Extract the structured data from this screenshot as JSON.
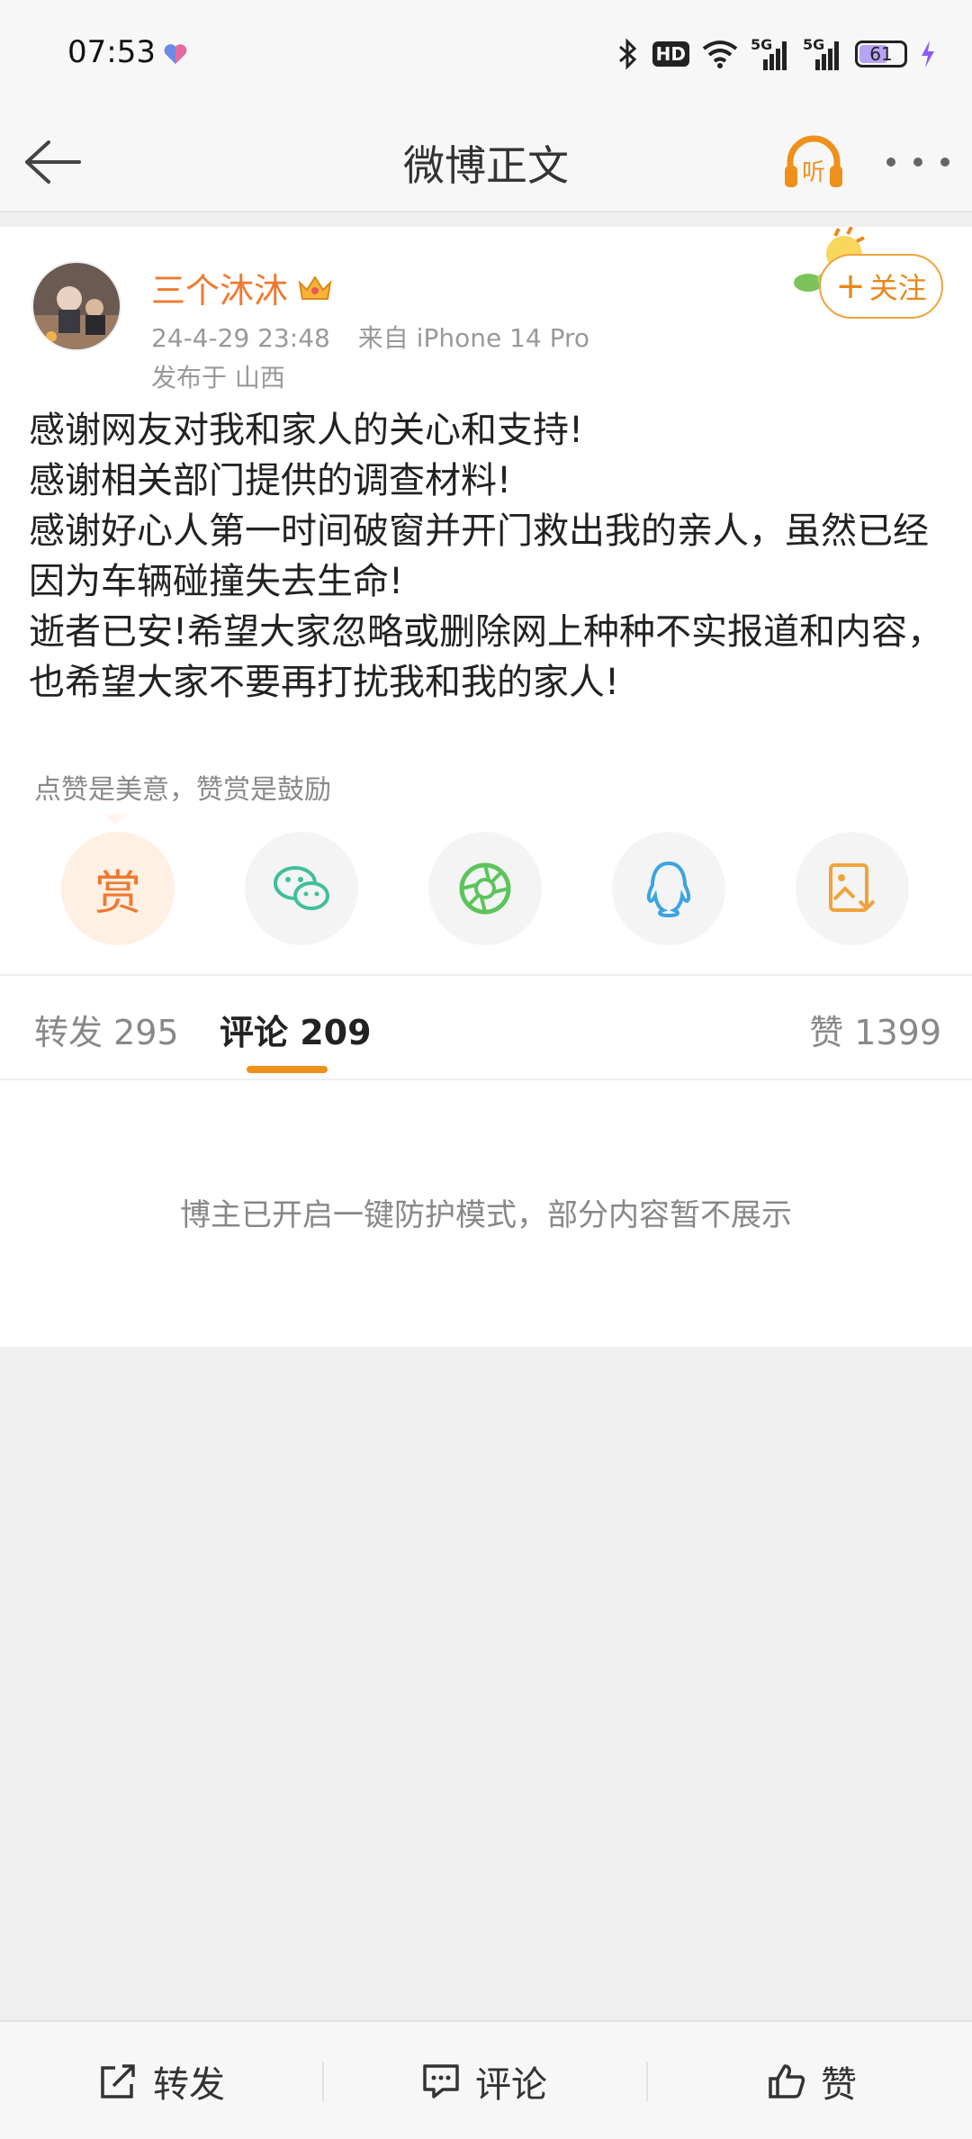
{
  "status_bar": {
    "time": "07:53",
    "battery": "61",
    "hd_label": "HD",
    "net_1": "5G",
    "net_2": "5G"
  },
  "nav": {
    "title": "微博正文",
    "listen_label": "听"
  },
  "post": {
    "username": "三个沐沐",
    "timestamp": "24-4-29 23:48",
    "source": "来自 iPhone 14 Pro",
    "location": "发布于 山西",
    "follow_label": "关注",
    "body": [
      "感谢网友对我和家人的关心和支持!",
      "感谢相关部门提供的调查材料!",
      "感谢好心人第一时间破窗并开门救出我的亲人，虽然已经因为车辆碰撞失去生命!",
      "逝者已安!希望大家忽略或删除网上种种不实报道和内容，也希望大家不要再打扰我和我的家人!"
    ],
    "reward_hint": "点赞是美意，赞赏是鼓励",
    "reward_label": "赏"
  },
  "share_icons": [
    "reward-icon",
    "wechat-icon",
    "moments-icon",
    "qq-icon",
    "save-image-icon"
  ],
  "tabs": {
    "repost": "转发 295",
    "comments": "评论 209",
    "likes": "赞 1399"
  },
  "notice": "博主已开启一键防护模式，部分内容暂不展示",
  "bottom_bar": {
    "repost": "转发",
    "comment": "评论",
    "like": "赞"
  },
  "colors": {
    "accent": "#f0782d",
    "tab_underline": "#f0901c"
  }
}
